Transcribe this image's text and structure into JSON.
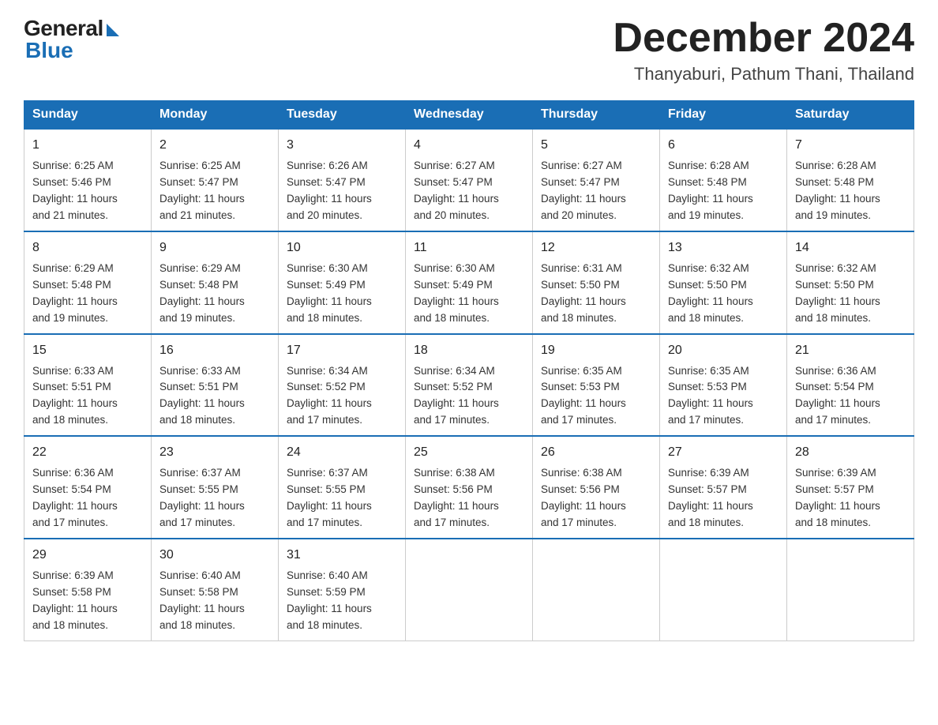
{
  "logo": {
    "general": "General",
    "blue": "Blue"
  },
  "title": "December 2024",
  "subtitle": "Thanyaburi, Pathum Thani, Thailand",
  "days_of_week": [
    "Sunday",
    "Monday",
    "Tuesday",
    "Wednesday",
    "Thursday",
    "Friday",
    "Saturday"
  ],
  "weeks": [
    [
      {
        "day": "1",
        "info": "Sunrise: 6:25 AM\nSunset: 5:46 PM\nDaylight: 11 hours\nand 21 minutes."
      },
      {
        "day": "2",
        "info": "Sunrise: 6:25 AM\nSunset: 5:47 PM\nDaylight: 11 hours\nand 21 minutes."
      },
      {
        "day": "3",
        "info": "Sunrise: 6:26 AM\nSunset: 5:47 PM\nDaylight: 11 hours\nand 20 minutes."
      },
      {
        "day": "4",
        "info": "Sunrise: 6:27 AM\nSunset: 5:47 PM\nDaylight: 11 hours\nand 20 minutes."
      },
      {
        "day": "5",
        "info": "Sunrise: 6:27 AM\nSunset: 5:47 PM\nDaylight: 11 hours\nand 20 minutes."
      },
      {
        "day": "6",
        "info": "Sunrise: 6:28 AM\nSunset: 5:48 PM\nDaylight: 11 hours\nand 19 minutes."
      },
      {
        "day": "7",
        "info": "Sunrise: 6:28 AM\nSunset: 5:48 PM\nDaylight: 11 hours\nand 19 minutes."
      }
    ],
    [
      {
        "day": "8",
        "info": "Sunrise: 6:29 AM\nSunset: 5:48 PM\nDaylight: 11 hours\nand 19 minutes."
      },
      {
        "day": "9",
        "info": "Sunrise: 6:29 AM\nSunset: 5:48 PM\nDaylight: 11 hours\nand 19 minutes."
      },
      {
        "day": "10",
        "info": "Sunrise: 6:30 AM\nSunset: 5:49 PM\nDaylight: 11 hours\nand 18 minutes."
      },
      {
        "day": "11",
        "info": "Sunrise: 6:30 AM\nSunset: 5:49 PM\nDaylight: 11 hours\nand 18 minutes."
      },
      {
        "day": "12",
        "info": "Sunrise: 6:31 AM\nSunset: 5:50 PM\nDaylight: 11 hours\nand 18 minutes."
      },
      {
        "day": "13",
        "info": "Sunrise: 6:32 AM\nSunset: 5:50 PM\nDaylight: 11 hours\nand 18 minutes."
      },
      {
        "day": "14",
        "info": "Sunrise: 6:32 AM\nSunset: 5:50 PM\nDaylight: 11 hours\nand 18 minutes."
      }
    ],
    [
      {
        "day": "15",
        "info": "Sunrise: 6:33 AM\nSunset: 5:51 PM\nDaylight: 11 hours\nand 18 minutes."
      },
      {
        "day": "16",
        "info": "Sunrise: 6:33 AM\nSunset: 5:51 PM\nDaylight: 11 hours\nand 18 minutes."
      },
      {
        "day": "17",
        "info": "Sunrise: 6:34 AM\nSunset: 5:52 PM\nDaylight: 11 hours\nand 17 minutes."
      },
      {
        "day": "18",
        "info": "Sunrise: 6:34 AM\nSunset: 5:52 PM\nDaylight: 11 hours\nand 17 minutes."
      },
      {
        "day": "19",
        "info": "Sunrise: 6:35 AM\nSunset: 5:53 PM\nDaylight: 11 hours\nand 17 minutes."
      },
      {
        "day": "20",
        "info": "Sunrise: 6:35 AM\nSunset: 5:53 PM\nDaylight: 11 hours\nand 17 minutes."
      },
      {
        "day": "21",
        "info": "Sunrise: 6:36 AM\nSunset: 5:54 PM\nDaylight: 11 hours\nand 17 minutes."
      }
    ],
    [
      {
        "day": "22",
        "info": "Sunrise: 6:36 AM\nSunset: 5:54 PM\nDaylight: 11 hours\nand 17 minutes."
      },
      {
        "day": "23",
        "info": "Sunrise: 6:37 AM\nSunset: 5:55 PM\nDaylight: 11 hours\nand 17 minutes."
      },
      {
        "day": "24",
        "info": "Sunrise: 6:37 AM\nSunset: 5:55 PM\nDaylight: 11 hours\nand 17 minutes."
      },
      {
        "day": "25",
        "info": "Sunrise: 6:38 AM\nSunset: 5:56 PM\nDaylight: 11 hours\nand 17 minutes."
      },
      {
        "day": "26",
        "info": "Sunrise: 6:38 AM\nSunset: 5:56 PM\nDaylight: 11 hours\nand 17 minutes."
      },
      {
        "day": "27",
        "info": "Sunrise: 6:39 AM\nSunset: 5:57 PM\nDaylight: 11 hours\nand 18 minutes."
      },
      {
        "day": "28",
        "info": "Sunrise: 6:39 AM\nSunset: 5:57 PM\nDaylight: 11 hours\nand 18 minutes."
      }
    ],
    [
      {
        "day": "29",
        "info": "Sunrise: 6:39 AM\nSunset: 5:58 PM\nDaylight: 11 hours\nand 18 minutes."
      },
      {
        "day": "30",
        "info": "Sunrise: 6:40 AM\nSunset: 5:58 PM\nDaylight: 11 hours\nand 18 minutes."
      },
      {
        "day": "31",
        "info": "Sunrise: 6:40 AM\nSunset: 5:59 PM\nDaylight: 11 hours\nand 18 minutes."
      },
      {
        "day": "",
        "info": ""
      },
      {
        "day": "",
        "info": ""
      },
      {
        "day": "",
        "info": ""
      },
      {
        "day": "",
        "info": ""
      }
    ]
  ]
}
